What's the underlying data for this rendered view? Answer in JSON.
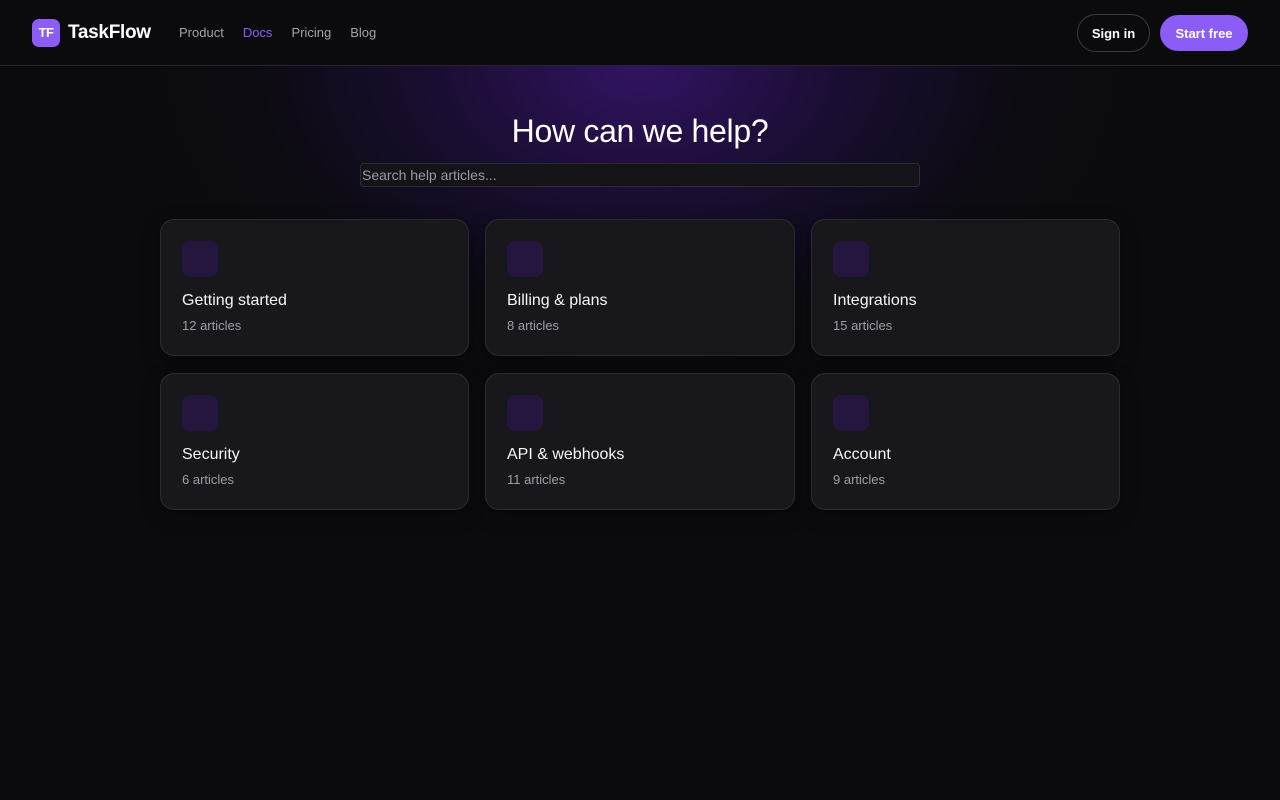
{
  "brand": {
    "logo_mark": "TF",
    "name": "TaskFlow",
    "accent_color": "#8b5cf6"
  },
  "nav": {
    "items": [
      {
        "label": "Product",
        "active": false
      },
      {
        "label": "Docs",
        "active": true
      },
      {
        "label": "Pricing",
        "active": false
      },
      {
        "label": "Blog",
        "active": false
      }
    ]
  },
  "header_actions": {
    "signin_label": "Sign in",
    "start_label": "Start free"
  },
  "hero": {
    "title": "How can we help?",
    "search_placeholder": "Search help articles...",
    "search_value": ""
  },
  "categories": [
    {
      "title": "Getting started",
      "count": "12 articles"
    },
    {
      "title": "Billing & plans",
      "count": "8 articles"
    },
    {
      "title": "Integrations",
      "count": "15 articles"
    },
    {
      "title": "Security",
      "count": "6 articles"
    },
    {
      "title": "API & webhooks",
      "count": "11 articles"
    },
    {
      "title": "Account",
      "count": "9 articles"
    }
  ]
}
